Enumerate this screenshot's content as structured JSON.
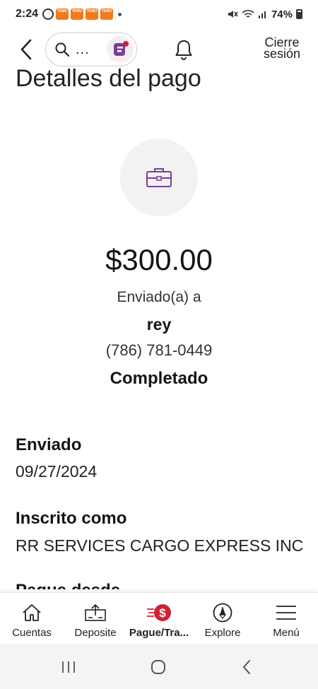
{
  "status_bar": {
    "time": "2:24",
    "battery": "74%",
    "notif_badge_text": "TEMU"
  },
  "header": {
    "search_ellipsis": "...",
    "logout_label_line1": "Cierre",
    "logout_label_line2": "sesión"
  },
  "payment": {
    "title": "Detalles del pago",
    "amount": "$300.00",
    "sent_to_label": "Enviado(a) a",
    "recipient_name": "rey",
    "recipient_phone": "(786) 781-0449",
    "status": "Completado"
  },
  "details": [
    {
      "label": "Enviado",
      "value": "09/27/2024"
    },
    {
      "label": "Inscrito como",
      "value": "RR SERVICES CARGO EXPRESS INC"
    },
    {
      "label": "Pague desde",
      "value": ""
    }
  ],
  "bottom_nav": {
    "items": [
      {
        "label": "Cuentas",
        "icon": "home-icon"
      },
      {
        "label": "Deposite",
        "icon": "deposit-icon"
      },
      {
        "label": "Pague/Tra...",
        "icon": "pay-transfer-icon",
        "active": true
      },
      {
        "label": "Explore",
        "icon": "compass-icon"
      },
      {
        "label": "Menú",
        "icon": "menu-icon"
      }
    ]
  },
  "colors": {
    "accent_purple": "#7a3f94",
    "pay_red": "#d32033",
    "badge_orange": "#f07b1e"
  }
}
